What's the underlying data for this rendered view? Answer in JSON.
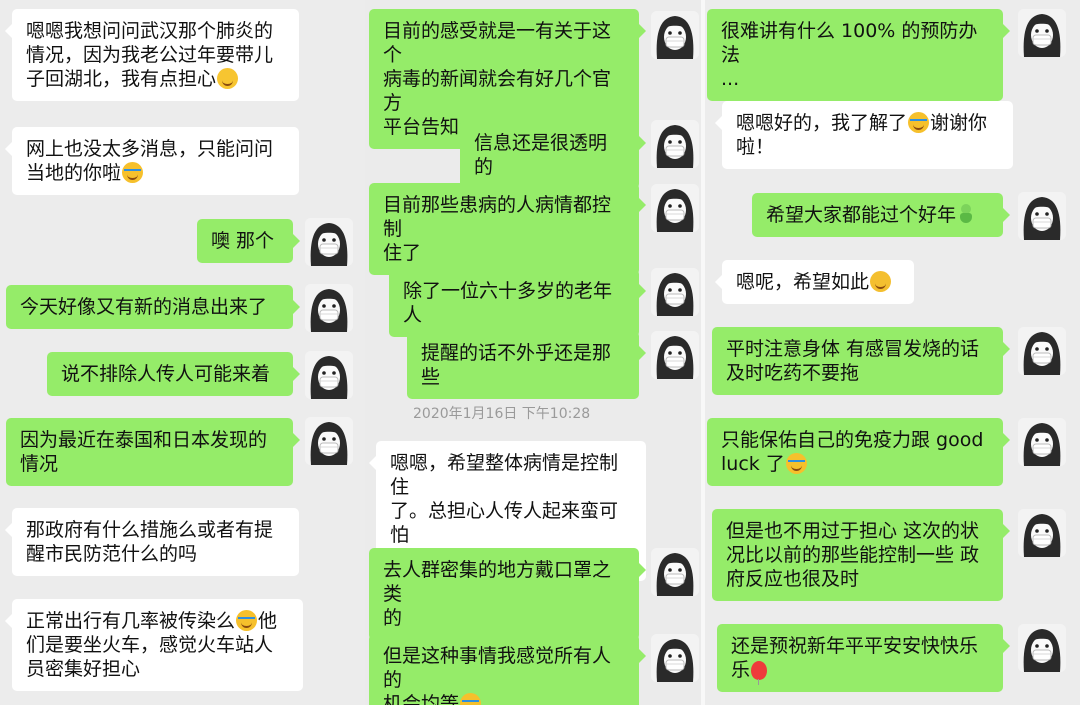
{
  "column1": {
    "messages": [
      {
        "lines": "嗯嗯我想问问武汉那个肺炎的\n情况，因为我老公过年要带儿\n子回湖北，我有点担心",
        "emoji": "flushed-face-emoji"
      },
      {
        "lines": "网上也没太多消息，只能问问\n当地的你啦",
        "emoji": "laughing-tears-emoji"
      },
      {
        "lines": "噢 那个"
      },
      {
        "lines": "今天好像又有新的消息出来了"
      },
      {
        "lines": "说不排除人传人可能来着"
      },
      {
        "lines": "因为最近在泰国和日本发现的\n情况"
      },
      {
        "lines": "那政府有什么措施么或者有提\n醒市民防范什么的吗"
      },
      {
        "lines": "正常出行有几率被传染么",
        "emoji": "laughing-tears-emoji",
        "tail": "他\n们是要坐火车，感觉火车站人\n员密集好担心"
      }
    ]
  },
  "column2": {
    "timestamp": "2020年1月16日 下午10:28",
    "messages": [
      {
        "lines": "目前的感受就是一有关于这个\n病毒的新闻就会有好几个官方\n平台告知"
      },
      {
        "lines": "信息还是很透明的"
      },
      {
        "lines": "目前那些患病的人病情都控制\n住了"
      },
      {
        "lines": "除了一位六十多岁的老年人"
      },
      {
        "lines": "提醒的话不外乎还是那些"
      },
      {
        "lines": "嗯嗯，希望整体病情是控制住\n了。总担心人传人起来蛮可怕\n的"
      },
      {
        "lines": "去人群密集的地方戴口罩之类\n的"
      },
      {
        "lines": "但是这种事情我感觉所有人的\n机会均等",
        "emoji": "laughing-tears-emoji"
      }
    ]
  },
  "column3": {
    "messages": [
      {
        "lines": "很难讲有什么 100% 的预防办法\n..."
      },
      {
        "lines": "嗯嗯好的，我了解了",
        "emoji": "laughing-tears-emoji",
        "tail": "谢谢你\n啦！"
      },
      {
        "lines": "希望大家都能过个好年",
        "emoji": "sprout-emoji"
      },
      {
        "lines": "嗯呢，希望如此",
        "emoji": "hugging-face-emoji"
      },
      {
        "lines": "平时注意身体 有感冒发烧的话\n及时吃药不要拖"
      },
      {
        "lines": "只能保佑自己的免疫力跟 good\nluck 了",
        "emoji": "laughing-tears-emoji"
      },
      {
        "lines": "但是也不用过于担心 这次的状\n况比以前的那些能控制一些 政\n府反应也很及时"
      },
      {
        "lines": "还是预祝新年平平安安快快乐\n乐",
        "emoji": "red-balloon-emoji"
      }
    ]
  },
  "colors": {
    "sent_bubble": "#95ec69",
    "received_bubble": "#ffffff",
    "background": "#ededed",
    "timestamp": "#9a9a9a"
  },
  "avatar_icon": "masked-girl-avatar-icon"
}
